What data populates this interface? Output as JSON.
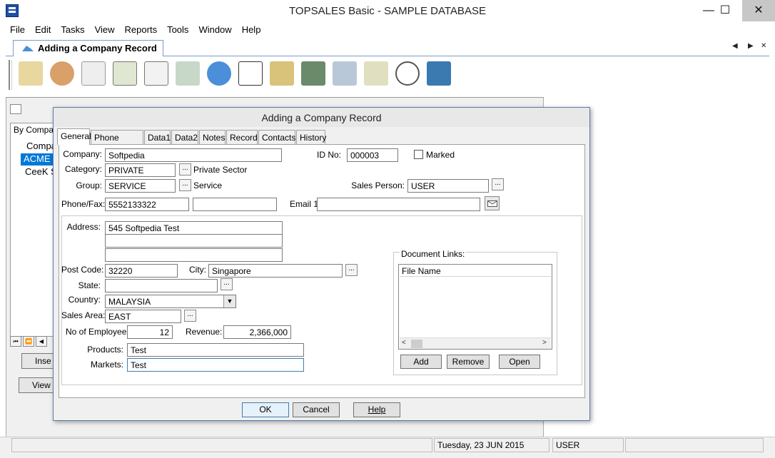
{
  "window": {
    "title": "TOPSALES Basic - SAMPLE DATABASE",
    "min": "—",
    "max": "☐",
    "close": "✕"
  },
  "menu": [
    "File",
    "Edit",
    "Tasks",
    "View",
    "Reports",
    "Tools",
    "Window",
    "Help"
  ],
  "doc_tab": {
    "label": "Adding a Company  Record",
    "prev": "◀",
    "next": "▶",
    "close": "✕"
  },
  "background_window": {
    "tab": "By Compa",
    "list": [
      "Compa",
      "ACME C",
      "CeeK S"
    ],
    "nav": [
      "⏮",
      "⏪",
      "◀"
    ],
    "insert_label": "Inse",
    "view_label": "View"
  },
  "dialog": {
    "title": "Adding a Company  Record",
    "tabs": [
      "General",
      "Phone /Email",
      "Data1",
      "Data2",
      "Notes",
      "Record",
      "Contacts",
      "History"
    ],
    "labels": {
      "company": "Company:",
      "id_no": "ID No:",
      "marked": "Marked",
      "category": "Category:",
      "group": "Group:",
      "sales_person": "Sales Person:",
      "phone_fax": "Phone/Fax:",
      "email1": "Email 1:",
      "address": "Address:",
      "post_code": "Post Code:",
      "city": "City:",
      "state": "State:",
      "country": "Country:",
      "sales_area": "Sales Area:",
      "employees": "No of Employees:",
      "revenue": "Revenue:",
      "products": "Products:",
      "markets": "Markets:",
      "document_links": "Document Links:",
      "file_name": "File Name"
    },
    "values": {
      "company": "Softpedia",
      "id_no": "000003",
      "category": "PRIVATE",
      "category_desc": "Private Sector",
      "group": "SERVICE",
      "group_desc": "Service",
      "sales_person": "USER",
      "phone": "5552133322",
      "fax": "",
      "email1": "",
      "address1": "545 Softpedia Test",
      "address2": "",
      "address3": "",
      "post_code": "32220",
      "city": "Singapore",
      "state": "",
      "country": "MALAYSIA",
      "sales_area": "EAST",
      "employees": "12",
      "revenue": "2,366,000",
      "products": "Test",
      "markets": "Test"
    },
    "ellipsis": "...",
    "doc_buttons": {
      "add": "Add",
      "remove": "Remove",
      "open": "Open"
    },
    "footer": {
      "ok": "OK",
      "cancel": "Cancel",
      "help": "Help"
    }
  },
  "statusbar": {
    "date": "Tuesday, 23 JUN 2015",
    "user": "USER"
  },
  "toolbar_icons": [
    "companies-icon",
    "contacts-icon",
    "tasks-icon",
    "documents-icon",
    "calendar-icon",
    "phone-icon",
    "internet-icon",
    "sales-icon",
    "cash-register-icon",
    "bank-icon",
    "stock-icon",
    "fax-icon",
    "stopwatch-icon",
    "calculator-icon"
  ]
}
